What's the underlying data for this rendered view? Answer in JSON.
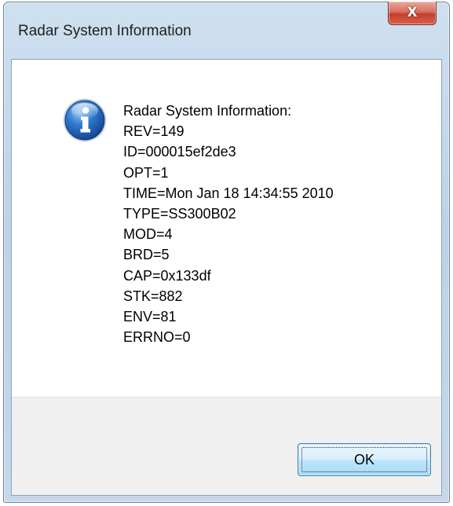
{
  "window": {
    "title": "Radar System Information",
    "close_glyph": "X"
  },
  "dialog": {
    "icon": "information-icon",
    "lines": [
      "Radar System Information:",
      "REV=149",
      "ID=000015ef2de3",
      "OPT=1",
      "TIME=Mon Jan 18 14:34:55 2010",
      "TYPE=SS300B02",
      "MOD=4",
      "BRD=5",
      "CAP=0x133df",
      "STK=882",
      "ENV=81",
      "ERRNO=0"
    ]
  },
  "buttons": {
    "ok_label": "OK"
  },
  "colors": {
    "close_button": "#c8452f",
    "ok_button_border": "#3c7fb1",
    "info_icon": "#1f5fb3",
    "footer_bg": "#f0f0f0"
  }
}
